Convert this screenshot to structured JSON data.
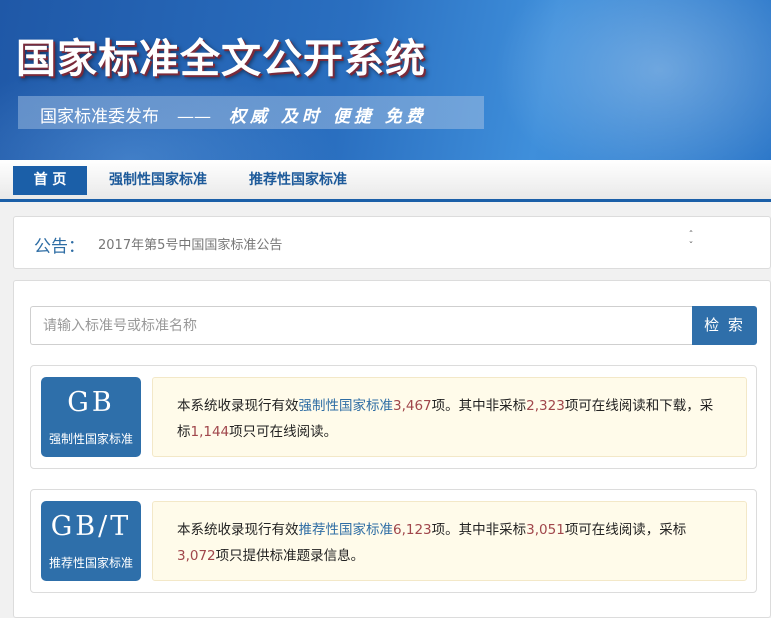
{
  "header": {
    "title": "国家标准全文公开系统",
    "slogan_publisher": "国家标准委发布",
    "slogan_dash": "——",
    "slogan_words": "权威 及时 便捷 免费"
  },
  "nav": {
    "items": [
      {
        "label": "首 页",
        "active": true
      },
      {
        "label": "强制性国家标准",
        "active": false
      },
      {
        "label": "推荐性国家标准",
        "active": false
      }
    ]
  },
  "notice": {
    "label": "公告：",
    "text": "2017年第5号中国国家标准公告",
    "arrow_up": "ˆ",
    "arrow_down": "ˇ"
  },
  "search": {
    "placeholder": "请输入标准号或标准名称",
    "value": "",
    "button_label": "检 索"
  },
  "cards": [
    {
      "code": "GB",
      "subtitle": "强制性国家标准",
      "text_1": "本系统收录现行有效",
      "link": "强制性国家标准",
      "count_total": "3,467",
      "text_2": "项。其中非采标",
      "count_a": "2,323",
      "text_3": "项可在线阅读和下载，采标",
      "count_b": "1,144",
      "text_4": "项只可在线阅读。"
    },
    {
      "code": "GB/T",
      "subtitle": "推荐性国家标准",
      "text_1": "本系统收录现行有效",
      "link": "推荐性国家标准",
      "count_total": "6,123",
      "text_2": "项。其中非采标",
      "count_a": "3,051",
      "text_3": "项可在线阅读，采标",
      "count_b": "3,072",
      "text_4": "项只提供标准题录信息。"
    }
  ],
  "colors": {
    "primary": "#2e6faa",
    "nav_border": "#1b5fa8",
    "number": "#a0464b",
    "desc_bg": "#fffbea"
  }
}
